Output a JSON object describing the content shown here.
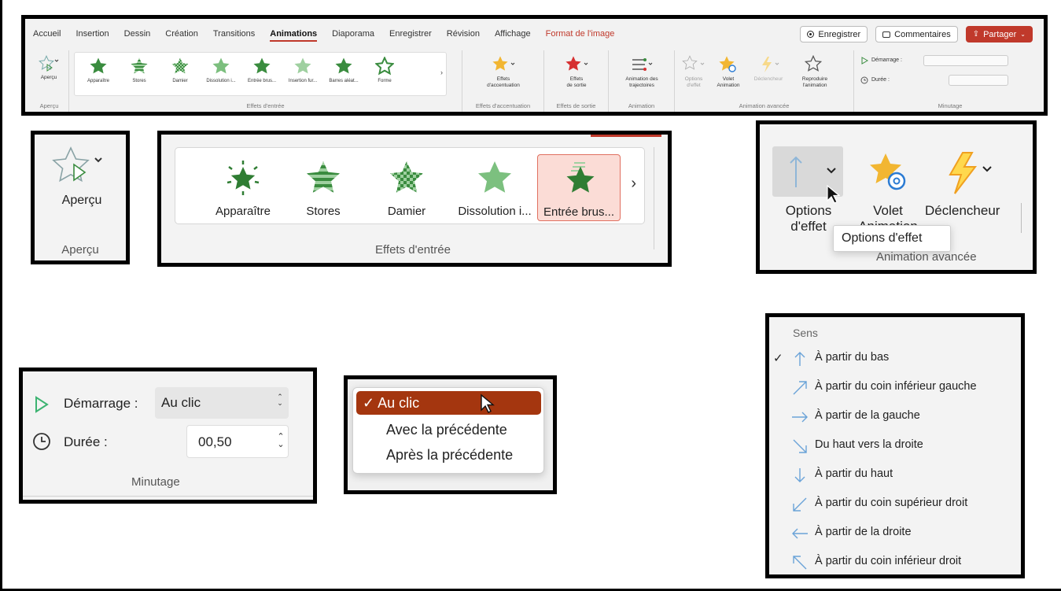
{
  "ribbon": {
    "tabs": [
      "Accueil",
      "Insertion",
      "Dessin",
      "Création",
      "Transitions",
      "Animations",
      "Diaporama",
      "Enregistrer",
      "Révision",
      "Affichage",
      "Format de l'image"
    ],
    "active_tab": "Animations",
    "enregistrer_button": "Enregistrer",
    "commentaires_button": "Commentaires",
    "partager_button": "Partager",
    "apercu_button": "Aperçu",
    "apercu_group": "Aperçu",
    "gallery_items": [
      "Apparaître",
      "Stores",
      "Damier",
      "Dissolution i...",
      "Entrée brus...",
      "Insertion fur...",
      "Barres aléat...",
      "Forme"
    ],
    "entry_group": "Effets d'entrée",
    "emphasis_button": [
      "Effets",
      "d'accentuation"
    ],
    "emphasis_group": "Effets d'accentuation",
    "exit_button": [
      "Effets",
      "de sortie"
    ],
    "exit_group": "Effets de sortie",
    "path_button": [
      "Animation des",
      "trajectoires"
    ],
    "animation_group": "Animation",
    "options_button": [
      "Options",
      "d'effet"
    ],
    "volet_button": [
      "Volet",
      "Animation"
    ],
    "declencheur_button": "Déclencheur",
    "reproduire_button": [
      "Reproduire",
      "l'animation"
    ],
    "advanced_group": "Animation avancée",
    "demarrage_label": "Démarrage :",
    "duree_label": "Durée :",
    "timing_group": "Minutage",
    "colors": {
      "accent": "#c0392b",
      "star_green": "#3a8c3f",
      "emphasis_star": "#f2b632",
      "exit_star": "#d63031"
    }
  },
  "apercu_zoom": {
    "button_label": "Aperçu",
    "group_label": "Aperçu"
  },
  "effets_zoom": {
    "items": [
      "Apparaître",
      "Stores",
      "Damier",
      "Dissolution i...",
      "Entrée brus..."
    ],
    "selected": "Entrée brus...",
    "group_label": "Effets d'entrée"
  },
  "advanced_zoom": {
    "options_label": [
      "Options",
      "d'effet"
    ],
    "volet_label": [
      "Volet",
      "Animation"
    ],
    "declencheur_label": "Déclencheur",
    "tooltip": "Options d'effet",
    "group_label": "Animation avancée"
  },
  "timing_zoom": {
    "demarrage_label": "Démarrage :",
    "demarrage_value": "Au clic",
    "duree_label": "Durée :",
    "duree_value": "00,50",
    "group_label": "Minutage"
  },
  "start_menu": {
    "items": [
      "Au clic",
      "Avec la précédente",
      "Après la précédente"
    ],
    "selected": "Au clic",
    "check": "✓"
  },
  "sens_menu": {
    "header": "Sens",
    "items": [
      {
        "label": "À partir du bas",
        "arrow": "arrow-up-icon"
      },
      {
        "label": "À partir du coin inférieur gauche",
        "arrow": "arrow-up-right-icon"
      },
      {
        "label": "À partir de la gauche",
        "arrow": "arrow-right-icon"
      },
      {
        "label": "Du haut vers la droite",
        "arrow": "arrow-down-right-icon"
      },
      {
        "label": "À partir du haut",
        "arrow": "arrow-down-icon"
      },
      {
        "label": "À partir du coin supérieur droit",
        "arrow": "arrow-down-left-icon"
      },
      {
        "label": "À partir de la droite",
        "arrow": "arrow-left-icon"
      },
      {
        "label": "À partir du coin inférieur droit",
        "arrow": "arrow-up-left-icon"
      }
    ],
    "checked": "À partir du bas",
    "check": "✓"
  }
}
